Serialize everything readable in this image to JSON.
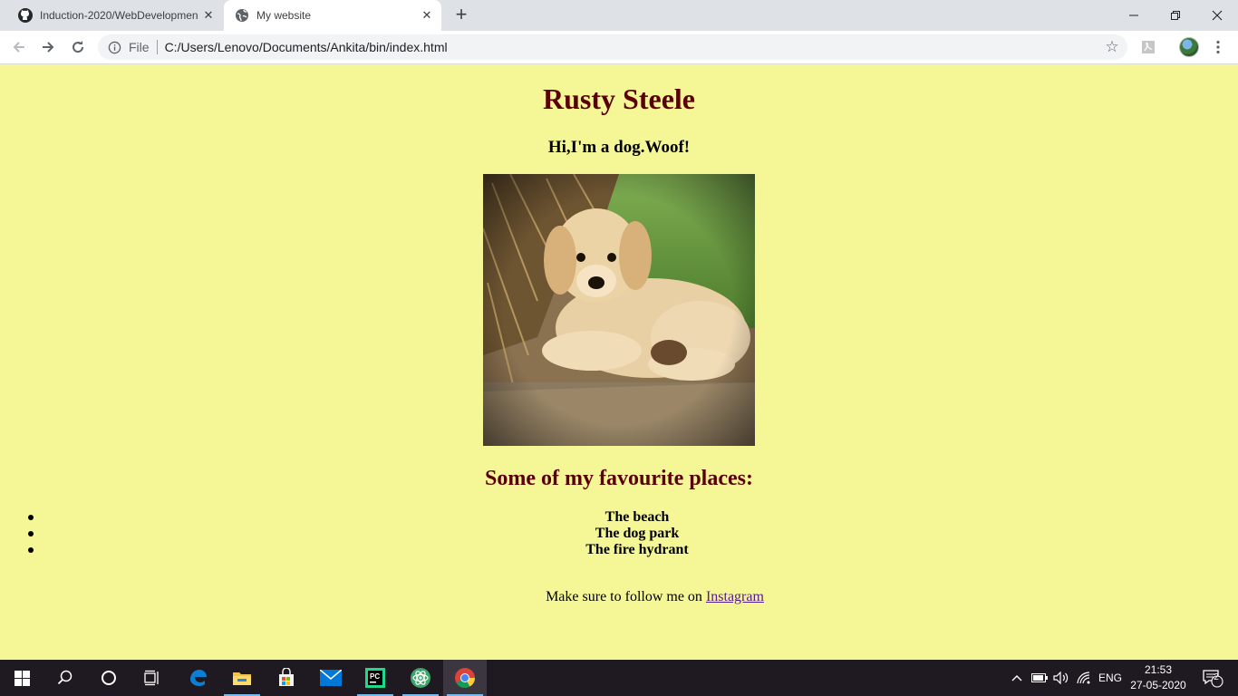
{
  "browser": {
    "tabs": [
      {
        "title": "Induction-2020/WebDevelopmen",
        "icon": "github-icon"
      },
      {
        "title": "My website",
        "icon": "globe-icon"
      }
    ],
    "omnibox": {
      "scheme_label": "File",
      "url": "C:/Users/Lenovo/Documents/Ankita/bin/index.html"
    }
  },
  "page": {
    "heading": "Rusty Steele",
    "subheading": "Hi,I'm a dog.Woof!",
    "photo_subject": "golden retriever puppy",
    "places_heading": "Some of my favourite places:",
    "places": [
      "The beach",
      "The dog park",
      "The fire hydrant"
    ],
    "follow_text": "Make sure to follow me on ",
    "follow_link": "Instagram",
    "background_color": "#f5f797",
    "heading_color": "#5b0000"
  },
  "taskbar": {
    "language": "ENG",
    "time": "21:53",
    "date": "27-05-2020",
    "notification_count": "2"
  }
}
